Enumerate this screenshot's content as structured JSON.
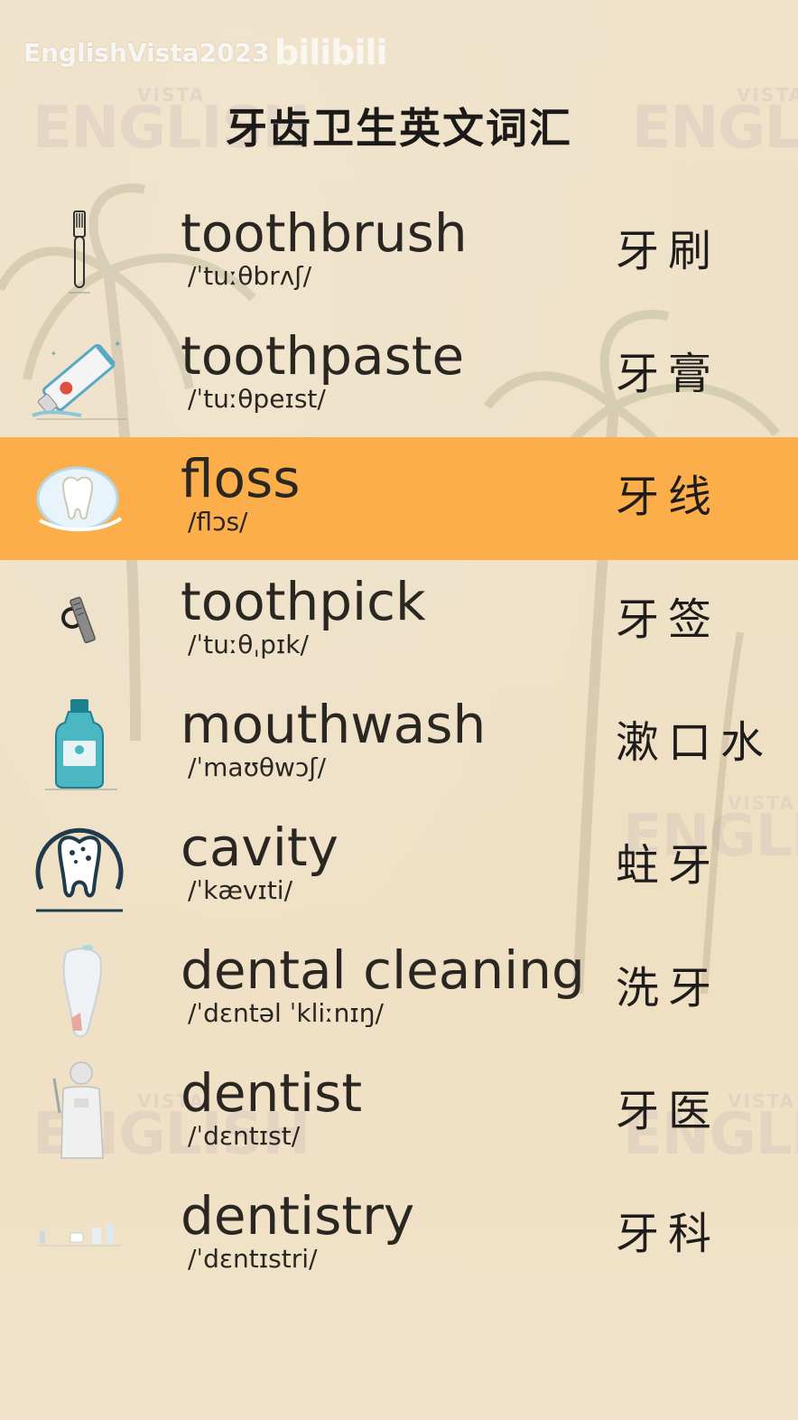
{
  "header": {
    "channel": "EnglishVista2023",
    "logo": "bilibili",
    "title": "牙齿卫生英文词汇"
  },
  "watermark": {
    "small": "VISTA",
    "big": "ENGLISH"
  },
  "colors": {
    "highlight": "#fbae4a",
    "background": "#f2e6cf",
    "text": "#2a2622"
  },
  "vocab": [
    {
      "word": "toothbrush",
      "phonetic": "/ˈtuːθbrʌʃ/",
      "chinese": "牙刷",
      "icon": "toothbrush-icon",
      "highlighted": false
    },
    {
      "word": "toothpaste",
      "phonetic": "/ˈtuːθpeɪst/",
      "chinese": "牙膏",
      "icon": "toothpaste-icon",
      "highlighted": false
    },
    {
      "word": "floss",
      "phonetic": "/flɔs/",
      "chinese": "牙线",
      "icon": "floss-icon",
      "highlighted": true
    },
    {
      "word": "toothpick",
      "phonetic": "/ˈtuːθˌpɪk/",
      "chinese": "牙签",
      "icon": "toothpick-icon",
      "highlighted": false
    },
    {
      "word": "mouthwash",
      "phonetic": "/ˈmaʊθwɔʃ/",
      "chinese": "漱口水",
      "icon": "mouthwash-icon",
      "highlighted": false
    },
    {
      "word": "cavity",
      "phonetic": "/ˈkævɪti/",
      "chinese": "蛀牙",
      "icon": "cavity-icon",
      "highlighted": false
    },
    {
      "word": "dental cleaning",
      "phonetic": "/ˈdɛntəl ˈkliːnɪŋ/",
      "chinese": "洗牙",
      "icon": "dental-cleaning-icon",
      "highlighted": false
    },
    {
      "word": "dentist",
      "phonetic": "/ˈdɛntɪst/",
      "chinese": "牙医",
      "icon": "dentist-icon",
      "highlighted": false
    },
    {
      "word": "dentistry",
      "phonetic": "/ˈdɛntɪstri/",
      "chinese": "牙科",
      "icon": "dentistry-icon",
      "highlighted": false
    }
  ]
}
